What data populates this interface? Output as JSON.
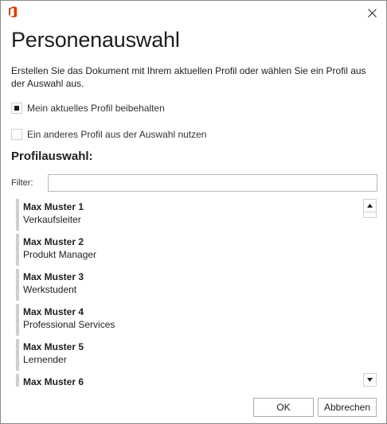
{
  "window": {
    "close_glyph": "✕",
    "brand_color": "#d83b01"
  },
  "title": "Personenauswahl",
  "description": "Erstellen Sie das Dokument mit Ihrem aktuellen Profil oder wählen Sie ein Profil aus der Auswahl aus.",
  "options": [
    {
      "label": "Mein aktuelles Profil beibehalten",
      "selected": true
    },
    {
      "label": "Ein anderes Profil aus der Auswahl nutzen",
      "selected": false
    }
  ],
  "section_title": "Profilauswahl:",
  "filter": {
    "label": "Filter:",
    "value": "",
    "placeholder": ""
  },
  "profiles": [
    {
      "name": "Max Muster 1",
      "role": "Verkaufsleiter"
    },
    {
      "name": "Max Muster 2",
      "role": "Produkt Manager"
    },
    {
      "name": "Max Muster 3",
      "role": "Werkstudent"
    },
    {
      "name": "Max Muster 4",
      "role": "Professional Services"
    },
    {
      "name": "Max Muster 5",
      "role": "Lernender"
    },
    {
      "name": "Max Muster 6",
      "role": ""
    }
  ],
  "buttons": {
    "ok": "OK",
    "cancel": "Abbrechen"
  }
}
